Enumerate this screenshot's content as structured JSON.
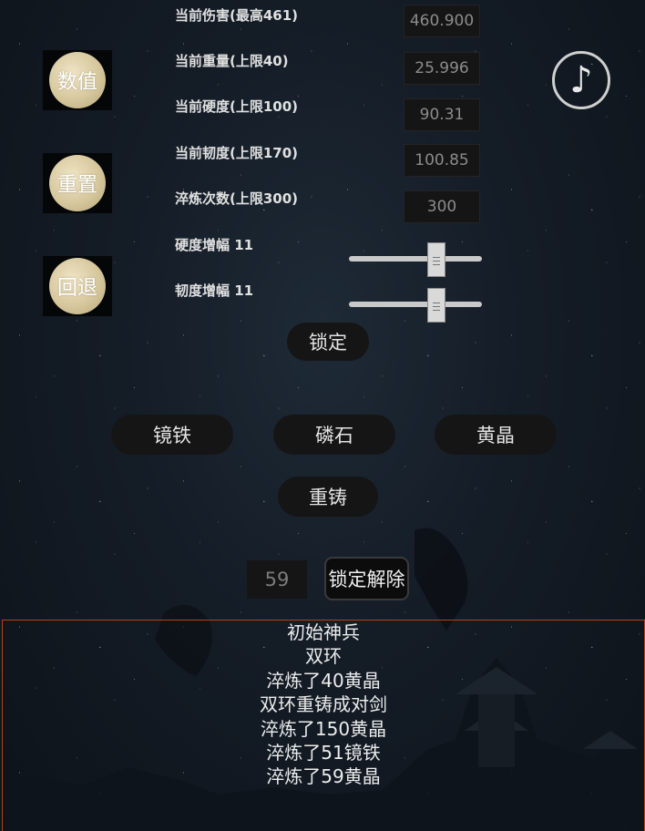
{
  "side_buttons": {
    "values_label": "数值",
    "reset_label": "重置",
    "undo_label": "回退"
  },
  "stats": {
    "damage": {
      "label": "当前伤害(最高461)",
      "value": "460.900"
    },
    "weight": {
      "label": "当前重量(上限40)",
      "value": "25.996"
    },
    "hardness": {
      "label": "当前硬度(上限100)",
      "value": "90.31"
    },
    "toughness": {
      "label": "当前韧度(上限170)",
      "value": "100.85"
    },
    "refine_count": {
      "label": "淬炼次数(上限300)",
      "value": "300"
    }
  },
  "sliders": {
    "hardness_gain": {
      "label": "硬度增幅 11",
      "fraction": 0.66
    },
    "toughness_gain": {
      "label": "韧度增幅 11",
      "fraction": 0.66
    }
  },
  "lock_label": "锁定",
  "materials": [
    "镜铁",
    "磷石",
    "黄晶"
  ],
  "recast_label": "重铸",
  "counter_value": "59",
  "unlock_label": "锁定解除",
  "music_icon": "music-note-icon",
  "log": {
    "lines": [
      "初始神兵",
      "双环",
      "淬炼了40黄晶",
      "双环重铸成对剑",
      "淬炼了150黄晶",
      "淬炼了51镜铁",
      "淬炼了59黄晶"
    ]
  },
  "colors": {
    "log_border": "#b34317",
    "moon": "#d6c79d"
  }
}
